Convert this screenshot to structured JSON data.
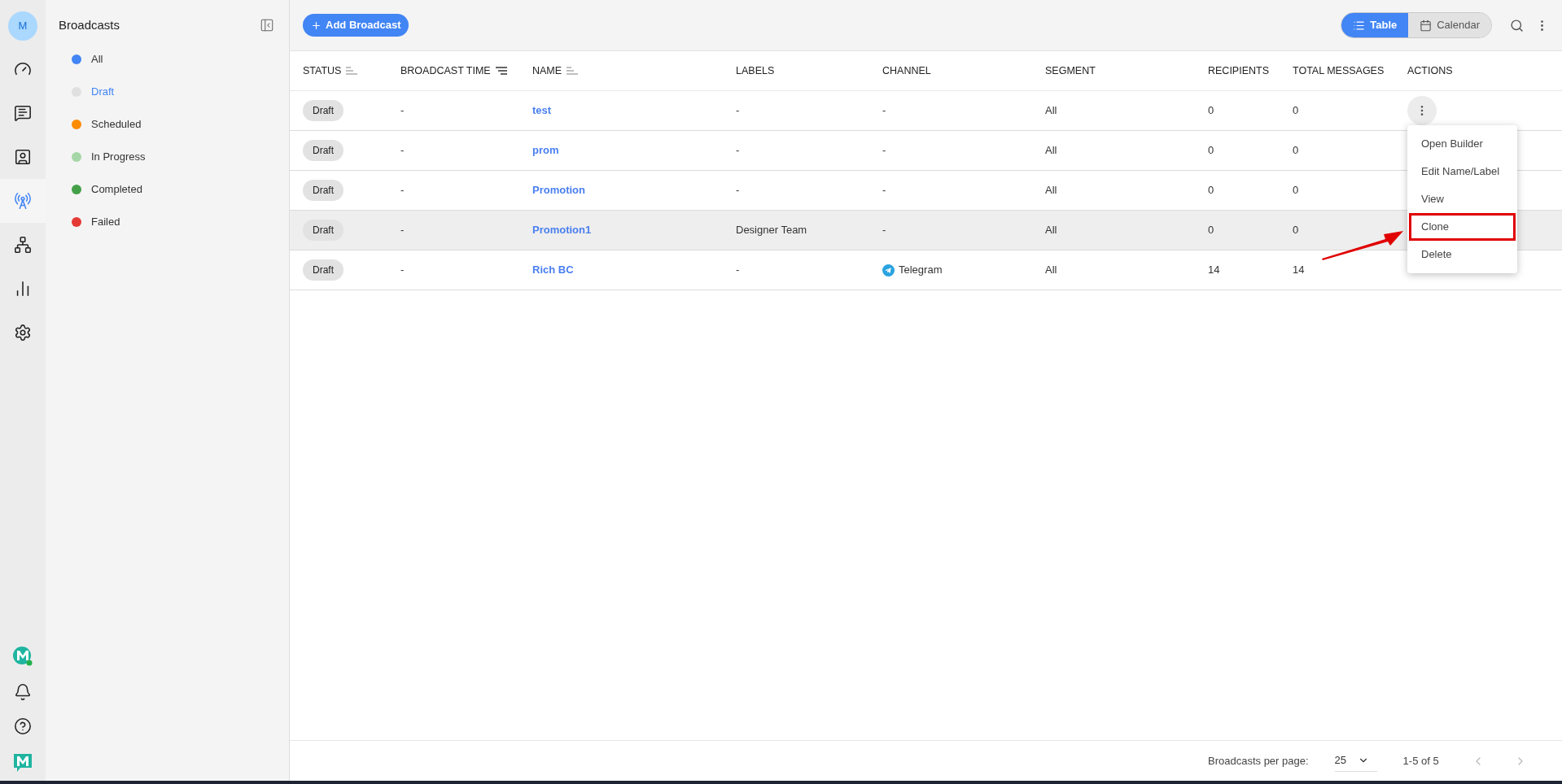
{
  "rail": {
    "avatar": "M",
    "items": [
      {
        "selected": false
      },
      {
        "selected": false
      },
      {
        "selected": false
      },
      {
        "selected": true
      },
      {
        "selected": false
      },
      {
        "selected": false
      },
      {
        "selected": false
      }
    ]
  },
  "sidebar": {
    "title": "Broadcasts",
    "items": [
      {
        "label": "All",
        "color": "#4285f4",
        "selected": false
      },
      {
        "label": "Draft",
        "color": "#e0e0e0",
        "selected": true
      },
      {
        "label": "Scheduled",
        "color": "#fb8c00",
        "selected": false
      },
      {
        "label": "In Progress",
        "color": "#a5d6a7",
        "selected": false
      },
      {
        "label": "Completed",
        "color": "#43a047",
        "selected": false
      },
      {
        "label": "Failed",
        "color": "#e53935",
        "selected": false
      }
    ]
  },
  "toolbar": {
    "add_button": "Add Broadcast",
    "views": [
      {
        "label": "Table",
        "selected": true
      },
      {
        "label": "Calendar",
        "selected": false
      }
    ]
  },
  "table": {
    "columns": [
      {
        "label": "STATUS",
        "sorted": false
      },
      {
        "label": "BROADCAST TIME",
        "sorted": true
      },
      {
        "label": "NAME",
        "sorted": false
      },
      {
        "label": "LABELS"
      },
      {
        "label": "CHANNEL"
      },
      {
        "label": "SEGMENT"
      },
      {
        "label": "RECIPIENTS"
      },
      {
        "label": "TOTAL MESSAGES"
      },
      {
        "label": "ACTIONS"
      }
    ],
    "rows": [
      {
        "status": "Draft",
        "time": "-",
        "name": "test",
        "labels": "-",
        "channel": "-",
        "channel_icon": false,
        "segment": "All",
        "recipients": "0",
        "total": "0",
        "selected": false,
        "menu_open": true
      },
      {
        "status": "Draft",
        "time": "-",
        "name": "prom",
        "labels": "-",
        "channel": "-",
        "channel_icon": false,
        "segment": "All",
        "recipients": "0",
        "total": "0",
        "selected": false,
        "menu_open": false
      },
      {
        "status": "Draft",
        "time": "-",
        "name": "Promotion",
        "labels": "-",
        "channel": "-",
        "channel_icon": false,
        "segment": "All",
        "recipients": "0",
        "total": "0",
        "selected": false,
        "menu_open": false
      },
      {
        "status": "Draft",
        "time": "-",
        "name": "Promotion1",
        "labels": "Designer Team",
        "channel": "-",
        "channel_icon": false,
        "segment": "All",
        "recipients": "0",
        "total": "0",
        "selected": true,
        "menu_open": false
      },
      {
        "status": "Draft",
        "time": "-",
        "name": "Rich BC",
        "labels": "-",
        "channel": "Telegram",
        "channel_icon": true,
        "segment": "All",
        "recipients": "14",
        "total": "14",
        "selected": false,
        "menu_open": false
      }
    ]
  },
  "menu": {
    "items": [
      {
        "label": "Open Builder",
        "highlighted": false
      },
      {
        "label": "Edit Name/Label",
        "highlighted": false
      },
      {
        "label": "View",
        "highlighted": false
      },
      {
        "label": "Clone",
        "highlighted": true
      },
      {
        "label": "Delete",
        "highlighted": false
      }
    ],
    "pointer_arrow": true
  },
  "footer": {
    "per_page_label": "Broadcasts per page:",
    "per_page": "25",
    "range": "1-5 of 5",
    "prev_disabled": true,
    "next_disabled": true
  }
}
